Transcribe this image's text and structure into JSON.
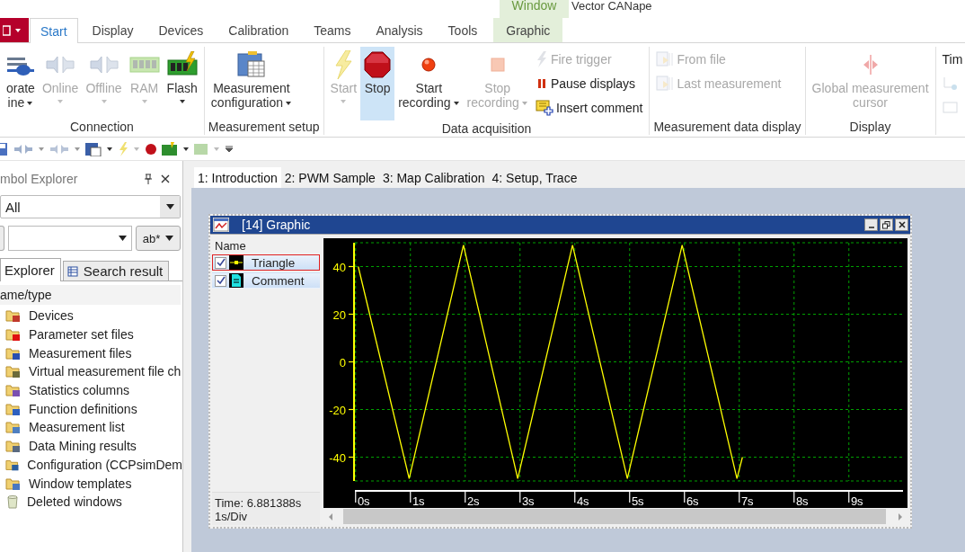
{
  "title_bar": {
    "contextual_group": "Window",
    "title": "Vector CANape"
  },
  "ribbon": {
    "tabs": [
      {
        "label": "Start",
        "selected": true,
        "kind": "normal"
      },
      {
        "label": "Display",
        "selected": false,
        "kind": "normal"
      },
      {
        "label": "Devices",
        "selected": false,
        "kind": "normal"
      },
      {
        "label": "Calibration",
        "selected": false,
        "kind": "normal"
      },
      {
        "label": "Teams",
        "selected": false,
        "kind": "normal"
      },
      {
        "label": "Analysis",
        "selected": false,
        "kind": "normal"
      },
      {
        "label": "Tools",
        "selected": false,
        "kind": "normal"
      },
      {
        "label": "Graphic",
        "selected": false,
        "kind": "contextual"
      }
    ],
    "groups": [
      {
        "label": "Connection",
        "items": [
          {
            "kind": "large",
            "label": "orate\nine",
            "disabled": false,
            "selected": false,
            "dropdown": true
          },
          {
            "kind": "large",
            "label": "Online",
            "disabled": true,
            "selected": false,
            "dropdown": true
          },
          {
            "kind": "large",
            "label": "Offline",
            "disabled": true,
            "selected": false,
            "dropdown": true
          },
          {
            "kind": "large",
            "label": "RAM",
            "disabled": true,
            "selected": false,
            "dropdown": true
          },
          {
            "kind": "large",
            "label": "Flash",
            "disabled": false,
            "selected": false,
            "dropdown": true
          }
        ]
      },
      {
        "label": "Measurement setup",
        "items": [
          {
            "kind": "large",
            "label": "Measurement\nconfiguration",
            "disabled": false,
            "selected": false,
            "dropdown": true
          }
        ]
      },
      {
        "label": "Data acquisition",
        "items": [
          {
            "kind": "large",
            "label": "Start",
            "disabled": true,
            "selected": false,
            "dropdown": true
          },
          {
            "kind": "large",
            "label": "Stop",
            "disabled": false,
            "selected": true,
            "dropdown": false
          },
          {
            "kind": "large",
            "label": "Start\nrecording",
            "disabled": false,
            "selected": false,
            "dropdown": true
          },
          {
            "kind": "large",
            "label": "Stop\nrecording",
            "disabled": true,
            "selected": false,
            "dropdown": true
          },
          {
            "kind": "stack",
            "buttons": [
              {
                "label": "Fire trigger",
                "disabled": true
              },
              {
                "label": "Pause displays",
                "disabled": false
              },
              {
                "label": "Insert comment",
                "disabled": false
              }
            ]
          }
        ]
      },
      {
        "label": "Measurement data display",
        "items": [
          {
            "kind": "stack",
            "buttons": [
              {
                "label": "From file",
                "disabled": true
              },
              {
                "label": "Last measurement",
                "disabled": true
              }
            ]
          }
        ]
      },
      {
        "label": "Display",
        "items": [
          {
            "kind": "large",
            "label": "Global measurement\ncursor",
            "disabled": true,
            "selected": false,
            "dropdown": false
          }
        ]
      },
      {
        "items": [
          {
            "kind": "stack",
            "buttons": [
              {
                "label": "Tim",
                "disabled": false
              },
              {
                "disabled": true
              },
              {
                "disabled": true
              }
            ]
          }
        ]
      }
    ]
  },
  "symbol_explorer": {
    "title": "mbol Explorer",
    "filter": {
      "value": "All"
    },
    "search_option": "ab*",
    "tabs": [
      {
        "label": "Explorer",
        "selected": true
      },
      {
        "label": "Search result",
        "selected": false
      }
    ],
    "column": "ame/type",
    "items": [
      {
        "label": "Devices"
      },
      {
        "label": "Parameter set files"
      },
      {
        "label": "Measurement files"
      },
      {
        "label": "Virtual measurement file ch"
      },
      {
        "label": "Statistics columns"
      },
      {
        "label": "Function definitions"
      },
      {
        "label": "Measurement list"
      },
      {
        "label": "Data Mining results"
      },
      {
        "label": "Configuration (CCPsimDem"
      },
      {
        "label": "Window templates"
      },
      {
        "label": "Deleted windows"
      }
    ]
  },
  "document_tabs": [
    {
      "label": "1: Introduction",
      "selected": true
    },
    {
      "label": "2: PWM Sample",
      "selected": false
    },
    {
      "label": "3: Map Calibration",
      "selected": false
    },
    {
      "label": "4: Setup, Trace",
      "selected": false
    }
  ],
  "graphic_window": {
    "title": "[14] Graphic",
    "legend_header": "Name",
    "signals": [
      {
        "checked": true,
        "selected": true,
        "kind": "line"
      },
      {
        "name": "Comment",
        "checked": true,
        "selected": false,
        "kind": "comment"
      }
    ],
    "time": "Time: 6.881388s",
    "scale": "1s/Div",
    "chart_data": {
      "type": "line",
      "grid": true,
      "xlim": [
        -0.16,
        9.84
      ],
      "ylim": [
        -50,
        50
      ],
      "x": [
        -0.1,
        0.83,
        1.82,
        2.81,
        3.81,
        4.81,
        5.81,
        6.81,
        6.91
      ],
      "series": [
        {
          "name": "Triangle",
          "color": "#ffff00",
          "values": [
            40,
            -49,
            49,
            -49,
            49,
            -49,
            49,
            -49,
            -40
          ]
        }
      ],
      "yticks": [
        -40,
        -20,
        0,
        20,
        40
      ],
      "xticks": [
        {
          "value": 0,
          "label": "0s"
        },
        {
          "value": 1,
          "label": "1s"
        },
        {
          "value": 2,
          "label": "2s"
        },
        {
          "value": 3,
          "label": "3s"
        },
        {
          "value": 4,
          "label": "4s"
        },
        {
          "value": 5,
          "label": "5s"
        },
        {
          "value": 6,
          "label": "6s"
        },
        {
          "value": 7,
          "label": "7s"
        },
        {
          "value": 8,
          "label": "8s"
        },
        {
          "value": 9,
          "label": "9s"
        }
      ]
    }
  }
}
